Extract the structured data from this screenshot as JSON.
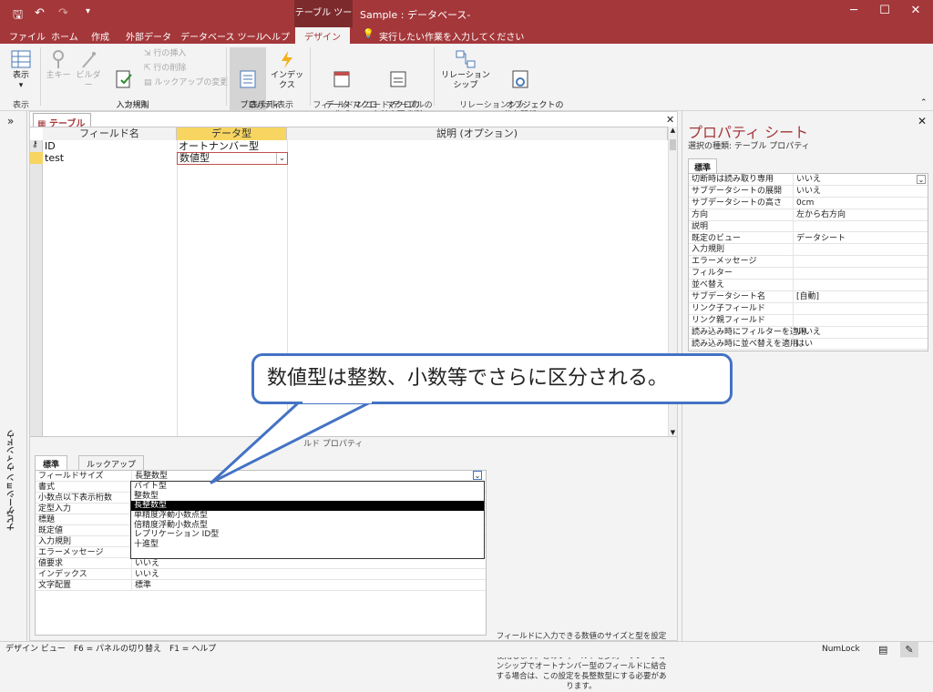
{
  "titlebar": {
    "tool_tab": "テーブル ツール",
    "title": "Sample : データベース-",
    "qat_save": "🖫",
    "qat_undo": "↶",
    "qat_redo": "↷",
    "qat_more": "▾"
  },
  "tabs": [
    "ファイル",
    "ホーム",
    "作成",
    "外部データ",
    "データベース ツール",
    "ヘルプ",
    "デザイン"
  ],
  "tell_me": "実行したい作業を入力してください",
  "ribbon": {
    "view": "表示",
    "primary_key": "主キー",
    "builder": "ビルダー",
    "test_rules": "入力規則\nのテスト",
    "insert_rows": "行の挿入",
    "delete_rows": "行の削除",
    "lookup_change": "ルックアップの変更",
    "property_sheet": "プロパティ\nシート",
    "indexes": "インデックス",
    "data_macro": "データ マクロ\nの作成 ▾",
    "rename_macro": "マクロの\n名前変更/削除",
    "relationships": "リレーションシップ",
    "object_deps": "オブジェクトの\n依存関係",
    "groups": [
      "表示",
      "ツール",
      "表示/非表示",
      "フィールド/レコード/テーブルのイベント",
      "リレーションシップ"
    ]
  },
  "nav_pane": "ナビゲーション ウィンドウ",
  "doc_tab": "テーブル1",
  "grid": {
    "headers": [
      "フィールド名",
      "データ型",
      "説明 (オプション)"
    ],
    "rows": [
      {
        "name": "ID",
        "type": "オートナンバー型"
      },
      {
        "name": "test",
        "type": "数値型"
      }
    ]
  },
  "field_props": {
    "tabs": [
      "標準",
      "ルックアップ"
    ],
    "rows": [
      {
        "name": "フィールドサイズ",
        "value": "長整数型"
      },
      {
        "name": "書式",
        "value": ""
      },
      {
        "name": "小数点以下表示桁数",
        "value": ""
      },
      {
        "name": "定型入力",
        "value": ""
      },
      {
        "name": "標題",
        "value": ""
      },
      {
        "name": "既定値",
        "value": ""
      },
      {
        "name": "入力規則",
        "value": ""
      },
      {
        "name": "エラーメッセージ",
        "value": ""
      },
      {
        "name": "値要求",
        "value": "いいえ"
      },
      {
        "name": "インデックス",
        "value": "いいえ"
      },
      {
        "name": "文字配置",
        "value": "標準"
      }
    ],
    "dropdown_options": [
      "バイト型",
      "整数型",
      "長整数型",
      "単精度浮動小数点型",
      "倍精度浮動小数点型",
      "レプリケーション ID型",
      "十進型"
    ],
    "dropdown_selected": "長整数型",
    "label": "ルド プロパティ",
    "hint": "フィールドに入力できる数値のサイズと型を設定します。通常は倍精度浮動小数点型と長整数型を使用します。このフィールドを多対一リレーションシップでオートナンバー型のフィールドに結合する場合は、この設定を長整数型にする必要があります。"
  },
  "property_sheet": {
    "title": "プロパティ シート",
    "subtitle": "選択の種類: テーブル プロパティ",
    "tab": "標準",
    "rows": [
      {
        "name": "切断時は読み取り専用",
        "value": "いいえ"
      },
      {
        "name": "サブデータシートの展開",
        "value": "いいえ"
      },
      {
        "name": "サブデータシートの高さ",
        "value": "0cm"
      },
      {
        "name": "方向",
        "value": "左から右方向"
      },
      {
        "name": "説明",
        "value": ""
      },
      {
        "name": "既定のビュー",
        "value": "データシート"
      },
      {
        "name": "入力規則",
        "value": ""
      },
      {
        "name": "エラーメッセージ",
        "value": ""
      },
      {
        "name": "フィルター",
        "value": ""
      },
      {
        "name": "並べ替え",
        "value": ""
      },
      {
        "name": "サブデータシート名",
        "value": "[自動]"
      },
      {
        "name": "リンク子フィールド",
        "value": ""
      },
      {
        "name": "リンク親フィールド",
        "value": ""
      },
      {
        "name": "読み込み時にフィルターを適用",
        "value": "いいえ"
      },
      {
        "name": "読み込み時に並べ替えを適用",
        "value": "はい"
      }
    ]
  },
  "status": {
    "left": "デザイン ビュー　F6 = パネルの切り替え　F1 = ヘルプ",
    "numlock": "NumLock"
  },
  "callout": "数値型は整数、小数等でさらに区分される。"
}
